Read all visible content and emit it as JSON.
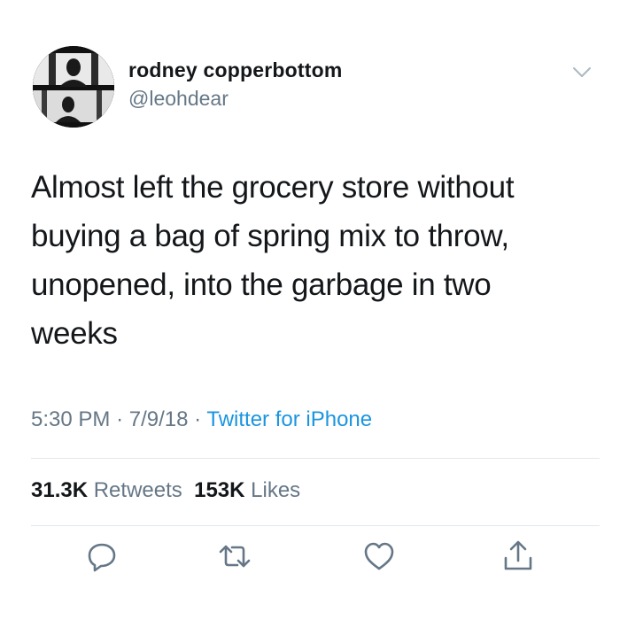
{
  "user": {
    "display_name": "rodney copperbottom",
    "handle": "@leohdear"
  },
  "tweet": {
    "text": "Almost left the grocery store without\nbuying a bag of spring mix to throw,\nunopened, into the garbage in two\nweeks",
    "time": "5:30 PM",
    "date": "7/9/18",
    "separator": "·",
    "source": "Twitter for iPhone"
  },
  "stats": {
    "retweets_count": "31.3K",
    "retweets_label": "Retweets",
    "likes_count": "153K",
    "likes_label": "Likes"
  },
  "icons": {
    "reply": "reply-icon",
    "retweet": "retweet-icon",
    "like": "heart-icon",
    "share": "share-icon",
    "caret": "chevron-down-icon"
  },
  "colors": {
    "text": "#14171a",
    "secondary": "#657786",
    "link": "#1b95e0",
    "divider": "#e1e8ed"
  }
}
